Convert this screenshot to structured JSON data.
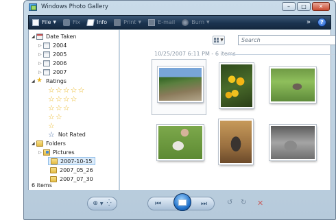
{
  "window": {
    "title": "Windows Photo Gallery",
    "buttons": {
      "minimize": "–",
      "maximize": "□",
      "close": "✕"
    }
  },
  "toolbar": {
    "file": "File",
    "fix": "Fix",
    "info": "Info",
    "print": "Print",
    "email": "E-mail",
    "burn": "Burn",
    "more": "»",
    "help": "?"
  },
  "nav": {
    "date_taken": "Date Taken",
    "years": [
      "2004",
      "2005",
      "2006",
      "2007"
    ],
    "ratings": "Ratings",
    "rating_rows": [
      5,
      4,
      3,
      2,
      1
    ],
    "not_rated": "Not Rated",
    "folders": "Folders",
    "pictures": "Pictures",
    "subfolders": [
      "2007-10-15",
      "2007_05_26",
      "2007_07_30"
    ],
    "selected_folder": "2007-10-15"
  },
  "content": {
    "search_placeholder": "Search",
    "group_header": "10/25/2007 6:11 PM - 6 items",
    "photos": [
      {
        "name": "mountain-road-photo"
      },
      {
        "name": "yellow-flowers-photo"
      },
      {
        "name": "cat-on-grass-photo"
      },
      {
        "name": "white-cat-photo"
      },
      {
        "name": "teapot-photo"
      },
      {
        "name": "bowl-photo"
      }
    ]
  },
  "status": {
    "count": "6 items"
  },
  "colors": {
    "toolbar": "#1b3450",
    "selection": "#dcecfb",
    "star": "#e9b520",
    "window_frame": "#c9dbe9"
  }
}
